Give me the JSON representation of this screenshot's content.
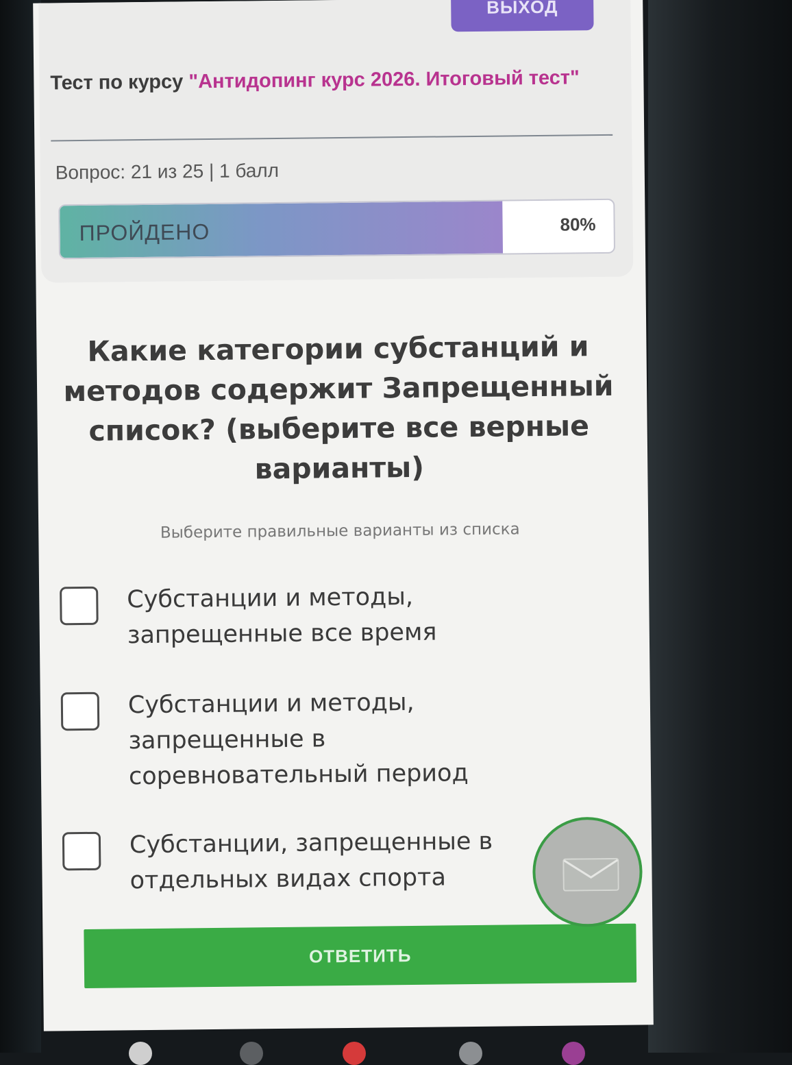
{
  "header": {
    "exit_label": "ВЫХОД",
    "course_prefix": "Тест по курсу ",
    "course_name": "\"Антидопинг курс 2026. Итоговый тест\"",
    "question_counter": "Вопрос: 21 из 25 | 1 балл"
  },
  "progress": {
    "label": "ПРОЙДЕНО",
    "percent_text": "80%",
    "fraction": 0.8
  },
  "question": {
    "text": "Какие категории субстанций и методов содержит Запрещенный список? (выберите все верные варианты)",
    "hint": "Выберите правильные варианты из списка"
  },
  "options": [
    {
      "label": "Субстанции и методы, запрещенные все время",
      "checked": false
    },
    {
      "label": "Субстанции и методы, запрещенные в соревновательный период",
      "checked": false
    },
    {
      "label": "Субстанции, запрещенные в отдельных видах спорта",
      "checked": false
    }
  ],
  "submit_label": "ОТВЕТИТЬ",
  "colors": {
    "accent_purple": "#7b62c4",
    "course_name": "#b8338f",
    "submit_green": "#3aab45"
  },
  "icons": {
    "chat": "mail-icon"
  }
}
